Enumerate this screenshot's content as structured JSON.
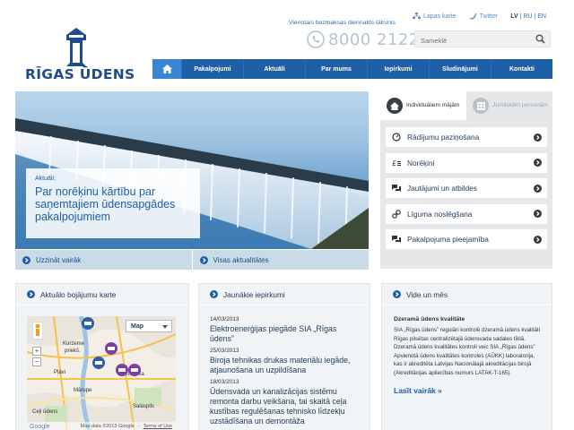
{
  "header": {
    "logo_text": "RĪGAS ŪDENS",
    "hotline_label": "Vienotais bezmaksas diennakts tālrunis",
    "hotline_number": "8000 2122",
    "sitemap_label": "Lapas karte",
    "twitter_label": "Twitter",
    "lang_lv": "LV",
    "lang_ru": "RU",
    "lang_en": "EN",
    "lang_sep1": "|",
    "lang_sep2": "|",
    "search_placeholder": "Sameklē"
  },
  "nav": {
    "items": [
      "Pakalpojumi",
      "Aktuāli",
      "Par mums",
      "Iepirkumi",
      "Sludinājumi",
      "Kontakti"
    ]
  },
  "hero": {
    "kicker": "Aktuāli:",
    "title": "Par norēķinu kārtību par saņemtajiem ūdensapgādes pakalpojumiem",
    "link_more": "Uzzināt vairāk",
    "link_all": "Visas aktualitātes"
  },
  "side": {
    "tab_individual": "Individuāliem mājām",
    "tab_legal": "Juridiskām personām",
    "items": [
      {
        "label": "Rādījumu paziņošana",
        "icon": "gauge-icon"
      },
      {
        "label": "Norēķini",
        "icon": "euro-icon"
      },
      {
        "label": "Jautājumi un atbildes",
        "icon": "chat-icon"
      },
      {
        "label": "Līguma noslēgšana",
        "icon": "link-icon"
      },
      {
        "label": "Pakalpojuma pieejamība",
        "icon": "chat-icon"
      }
    ]
  },
  "boxes": {
    "map": {
      "title": "Aktuālo bojājumu karte",
      "map_type": "Map",
      "labels": [
        "Kurzeme",
        "priekš.",
        "Pļavi",
        "Mārupe",
        "Ulbroka",
        "Salaspils",
        "Ceļi ūdens"
      ],
      "footer_data": "Map data ©2013 Google",
      "footer_sep": "-",
      "footer_terms": "Terms of Use",
      "google_brand": "Google"
    },
    "tenders": {
      "title": "Jaunākie iepirkumi",
      "items": [
        {
          "date": "14/03/2013",
          "title": "Elektroenerģijas piegāde SIA „Rīgas ūdens”"
        },
        {
          "date": "25/03/2013",
          "title": "Biroja tehnikas drukas materiālu iegāde, atjaunošana un uzpildīšana"
        },
        {
          "date": "18/03/2013",
          "title": "Ūdensvada un kanalizācijas sistēmu remonta darbu veikšana, tai skaitā ceļa kustības regulēšanas tehnisko līdzekļu uzstādīšana un demontāža"
        }
      ]
    },
    "video": {
      "title": "Vide un mēs",
      "heading": "Dzeramā ūdens kvalitāte",
      "text": "SIA „Rīgas ūdens” regulāri kontrolē dzeramā ūdens kvalitāti Rīgas pilsētas centralizētajā ūdensvada sadales tīklā. Dzeramā ūdens kvalitātes kontroli veic SIA „Rīgas ūdens” Apvienotā ūdens kvalitātes kontroles (AŪKK) laboratorija, kas ir akreditēta Latvijas Nacionālajā akreditācijas birojā (Akreditācijas apliecības numurs LATAK-T-165).",
      "more": "Lasīt vairāk »"
    }
  },
  "colors": {
    "brand_blue": "#1f5fa8",
    "light_blue": "#3a85d3",
    "panel_gray": "#e5e7e8"
  }
}
